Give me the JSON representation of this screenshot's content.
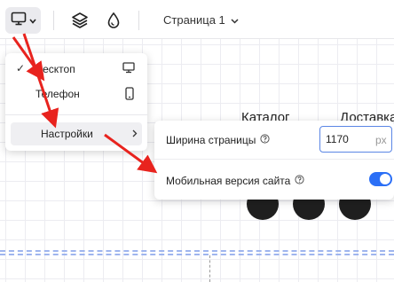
{
  "toolbar": {
    "page_selector_label": "Страница 1"
  },
  "device_menu": {
    "items": [
      {
        "label": "Десктоп",
        "checked": true,
        "icon": "monitor-icon"
      },
      {
        "label": "Телефон",
        "checked": false,
        "icon": "phone-icon"
      }
    ],
    "settings_label": "Настройки"
  },
  "settings_panel": {
    "page_width_label": "Ширина страницы",
    "page_width_value": "1170",
    "page_width_unit": "px",
    "mobile_version_label": "Мобильная версия сайта",
    "mobile_version_enabled": true
  },
  "site_preview": {
    "nav": [
      "Каталог",
      "Доставка"
    ]
  },
  "colors": {
    "accent": "#2b6ff6",
    "annotation_arrow": "#e8231e",
    "guide": "#9fb5ee"
  }
}
